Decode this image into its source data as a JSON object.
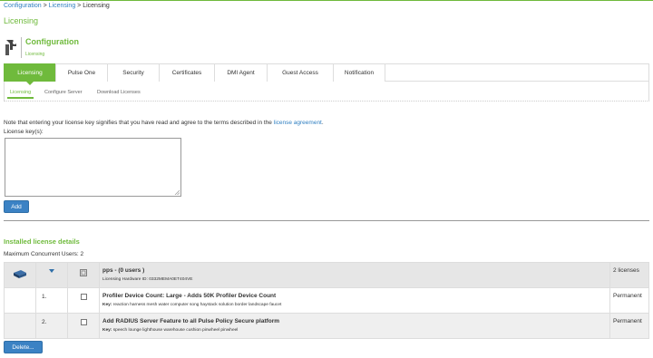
{
  "breadcrumb": {
    "items": [
      "Configuration",
      "Licensing"
    ],
    "current": "Licensing",
    "sep": ">"
  },
  "page_title": "Licensing",
  "config_header": {
    "title": "Configuration",
    "subtitle": "Licensing"
  },
  "tabs": [
    "Licensing",
    "Pulse One",
    "Security",
    "Certificates",
    "DMI Agent",
    "Guest Access",
    "Notification"
  ],
  "subtabs": [
    "Licensing",
    "Configure Server",
    "Download Licenses"
  ],
  "notice": {
    "text": "Note that entering your license key signifies that you have read and agree to the terms described in the",
    "link": "license agreement",
    "suffix": "."
  },
  "license_key_label": "License key(s):",
  "license_key_value": "",
  "add_label": "Add",
  "installed_title": "Installed license details",
  "max_users": "Maximum Concurrent Users: 2",
  "table": {
    "header": {
      "title": "pps - (0 users )",
      "hardware_label": "Licensing Hardware ID:",
      "hardware_id": "0332MEMA0ET404VE",
      "count": "2 licenses"
    },
    "rows": [
      {
        "index": "1.",
        "title": "Profiler Device Count: Large - Adds 50K Profiler Device Count",
        "key_label": "Key:",
        "key": "reaction harness mesh water computer song haystack solution border landscape faucet",
        "term": "Permanent"
      },
      {
        "index": "2.",
        "title": "Add RADIUS Server Feature to all Pulse Policy Secure platform",
        "key_label": "Key:",
        "key": "speech lounge lighthouse warehouse cushion pinwheel pinwheel",
        "term": "Permanent"
      }
    ]
  },
  "delete_label": "Delete...",
  "colors": {
    "accent": "#6fba3c",
    "link": "#2f7fc1",
    "button": "#3b82c4"
  }
}
